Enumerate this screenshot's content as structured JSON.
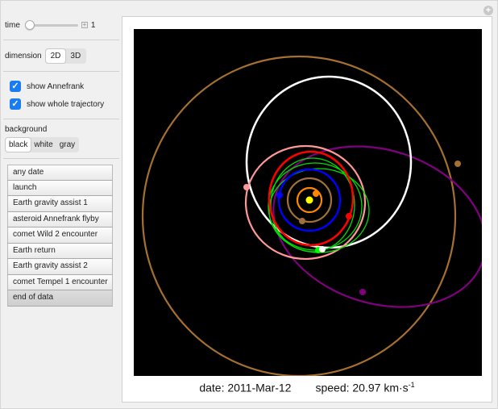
{
  "controls": {
    "time_label": "time",
    "time_value": "1",
    "dimension_label": "dimension",
    "dimension_options": [
      "2D",
      "3D"
    ],
    "dimension_selected": "2D",
    "show_annefrank_label": "show Annefrank",
    "show_annefrank_checked": true,
    "show_trajectory_label": "show whole trajectory",
    "show_trajectory_checked": true,
    "background_label": "background",
    "background_options": [
      "black",
      "white",
      "gray"
    ],
    "background_selected": "black",
    "buttons": [
      "any date",
      "launch",
      "Earth gravity assist 1",
      "asteroid Annefrank flyby",
      "comet Wild 2 encounter",
      "Earth return",
      "Earth gravity assist 2",
      "comet Tempel 1 encounter",
      "end of data"
    ],
    "active_button": "end of data"
  },
  "caption": {
    "date_text": "date: 2011-Mar-12",
    "speed_text": "speed: 20.97 km·s",
    "speed_exp": "-1"
  },
  "colors": {
    "background": "#000000",
    "sun": "#ffff00",
    "mercury": "#ff8800",
    "venus": "#a07040",
    "earth": "#0000ff",
    "mars": "#ff0000",
    "spacecraft_orbit": "#00ff00",
    "annefrank": "#ff9999",
    "wild2": "#ffffff",
    "tempel1": "#800080",
    "jupiter_outer": "#a67030"
  }
}
